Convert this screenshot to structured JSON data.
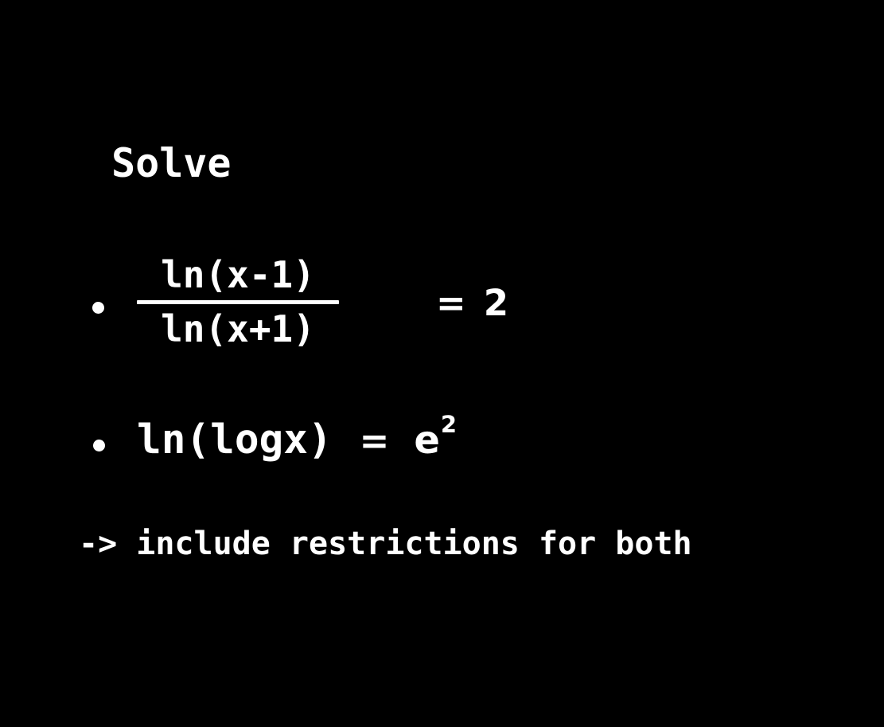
{
  "slide": {
    "background_color": "#000000",
    "text_color": "#ffffff",
    "title": "Solve",
    "note": "-> include restrictions for both"
  },
  "problems": [
    {
      "id": "problem-1",
      "bullet_glyph": "bullet-dot",
      "kind": "fraction-equation",
      "numerator": "ln(x-1)",
      "denominator": "ln(x+1)",
      "operator": "=",
      "right_side": "2",
      "plain_text": "ln(x-1)/ln(x+1) = 2"
    },
    {
      "id": "problem-2",
      "bullet_glyph": "bullet-dot",
      "kind": "inline-equation",
      "left_side": "ln(logx)",
      "operator": "=",
      "base": "e",
      "exponent": "2",
      "plain_text": "ln(logx) = e^2"
    }
  ]
}
